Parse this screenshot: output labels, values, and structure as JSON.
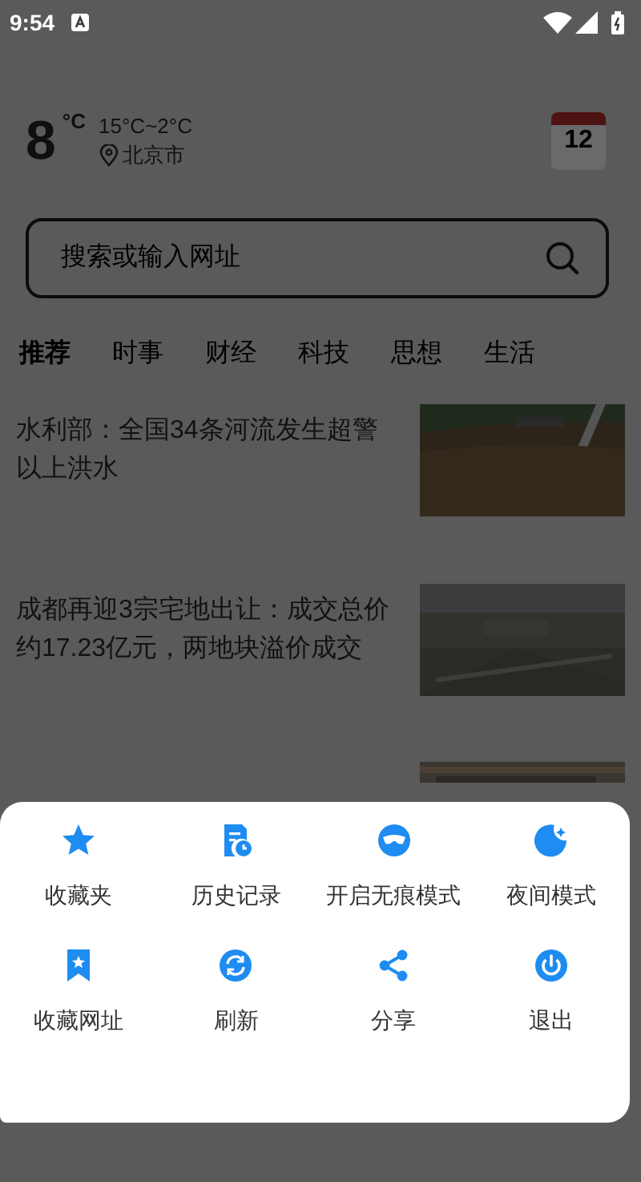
{
  "status_bar": {
    "time": "9:54"
  },
  "weather": {
    "temperature": "8",
    "unit": "°C",
    "range": "15°C~2°C",
    "city": "北京市",
    "calendar_day": "12"
  },
  "search": {
    "placeholder": "搜索或输入网址"
  },
  "tabs": [
    {
      "label": "推荐",
      "selected": true
    },
    {
      "label": "时事",
      "selected": false
    },
    {
      "label": "财经",
      "selected": false
    },
    {
      "label": "科技",
      "selected": false
    },
    {
      "label": "思想",
      "selected": false
    },
    {
      "label": "生活",
      "selected": false
    }
  ],
  "news": [
    {
      "title": "水利部：全国34条河流发生超警以上洪水"
    },
    {
      "title": "成都再迎3宗宅地出让：成交总价约17.23亿元，两地块溢价成交"
    }
  ],
  "menu": [
    {
      "kind": "star",
      "label": "收藏夹"
    },
    {
      "kind": "history",
      "label": "历史记录"
    },
    {
      "kind": "incognito",
      "label": "开启无痕模式"
    },
    {
      "kind": "night",
      "label": "夜间模式"
    },
    {
      "kind": "bookmark",
      "label": "收藏网址"
    },
    {
      "kind": "refresh",
      "label": "刷新"
    },
    {
      "kind": "share",
      "label": "分享"
    },
    {
      "kind": "exit",
      "label": "退出"
    }
  ]
}
